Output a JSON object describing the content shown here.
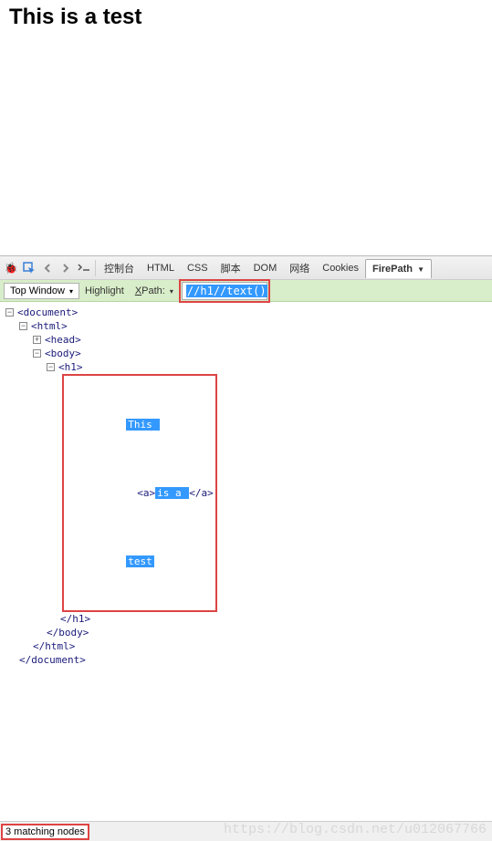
{
  "page": {
    "heading": "This is a test"
  },
  "toolbar": {
    "tabs": {
      "console": "控制台",
      "html": "HTML",
      "css": "CSS",
      "script": "脚本",
      "dom": "DOM",
      "network": "网络",
      "cookies": "Cookies",
      "firepath": "FirePath"
    }
  },
  "firepath_bar": {
    "context": "Top Window",
    "highlight": "Highlight",
    "xpath_label": "XPath:",
    "xpath_input": "//h1//text()"
  },
  "tree": {
    "t0": "<document>",
    "t1": "<html>",
    "t2": "<head>",
    "t3": "<body>",
    "t4": "<h1>",
    "text1": "This ",
    "a_open": "<a>",
    "text2": "is a ",
    "a_close": "</a>",
    "text3": "test",
    "t4c": "</h1>",
    "t3c": "</body>",
    "t1c": "</html>",
    "t0c": "</document>"
  },
  "status": {
    "result": "3 matching nodes"
  },
  "watermark": "https://blog.csdn.net/u012067766"
}
